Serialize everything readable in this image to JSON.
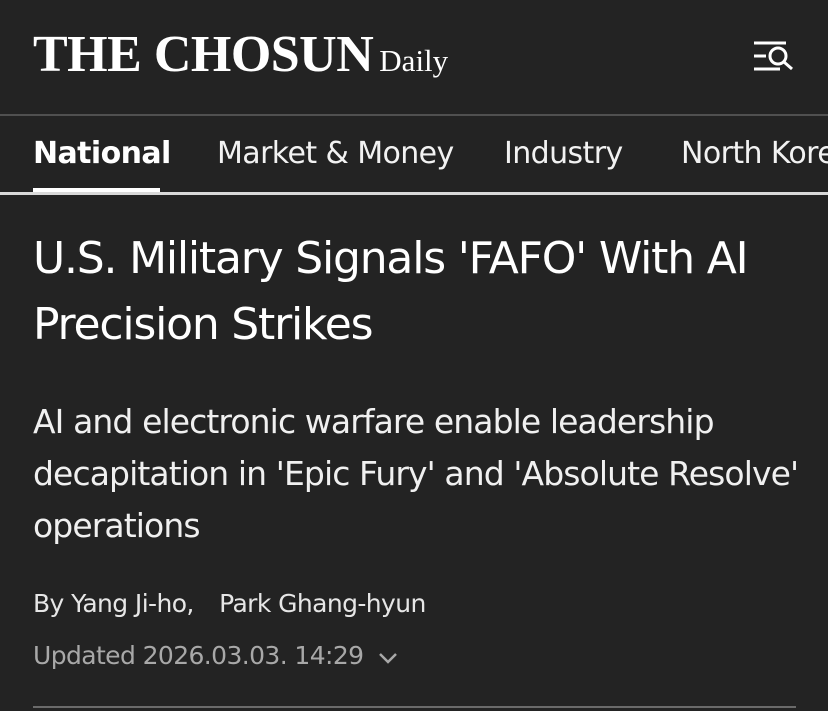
{
  "header": {
    "logo_main": "THE CHOSUN",
    "logo_sub": "Daily",
    "menu_icon": "menu-search-icon"
  },
  "nav": {
    "tabs": [
      {
        "label": "National",
        "active": true
      },
      {
        "label": "Market & Money",
        "active": false
      },
      {
        "label": "Industry",
        "active": false
      },
      {
        "label": "North Korea",
        "active": false
      }
    ]
  },
  "article": {
    "headline": "U.S. Military Signals 'FAFO' With AI Precision Strikes",
    "subheadline": "AI and electronic warfare enable leadership decapitation in 'Epic Fury' and 'Absolute Resolve' operations",
    "byline_prefix": "By",
    "authors": [
      "Yang Ji-ho,",
      "Park Ghang-hyun"
    ],
    "updated_label": "Updated",
    "updated_datetime": "2026.03.03. 14:29",
    "expand_icon": "chevron-down-icon"
  },
  "colors": {
    "background": "#232323",
    "text": "#ffffff",
    "muted": "#a8a8a8"
  }
}
